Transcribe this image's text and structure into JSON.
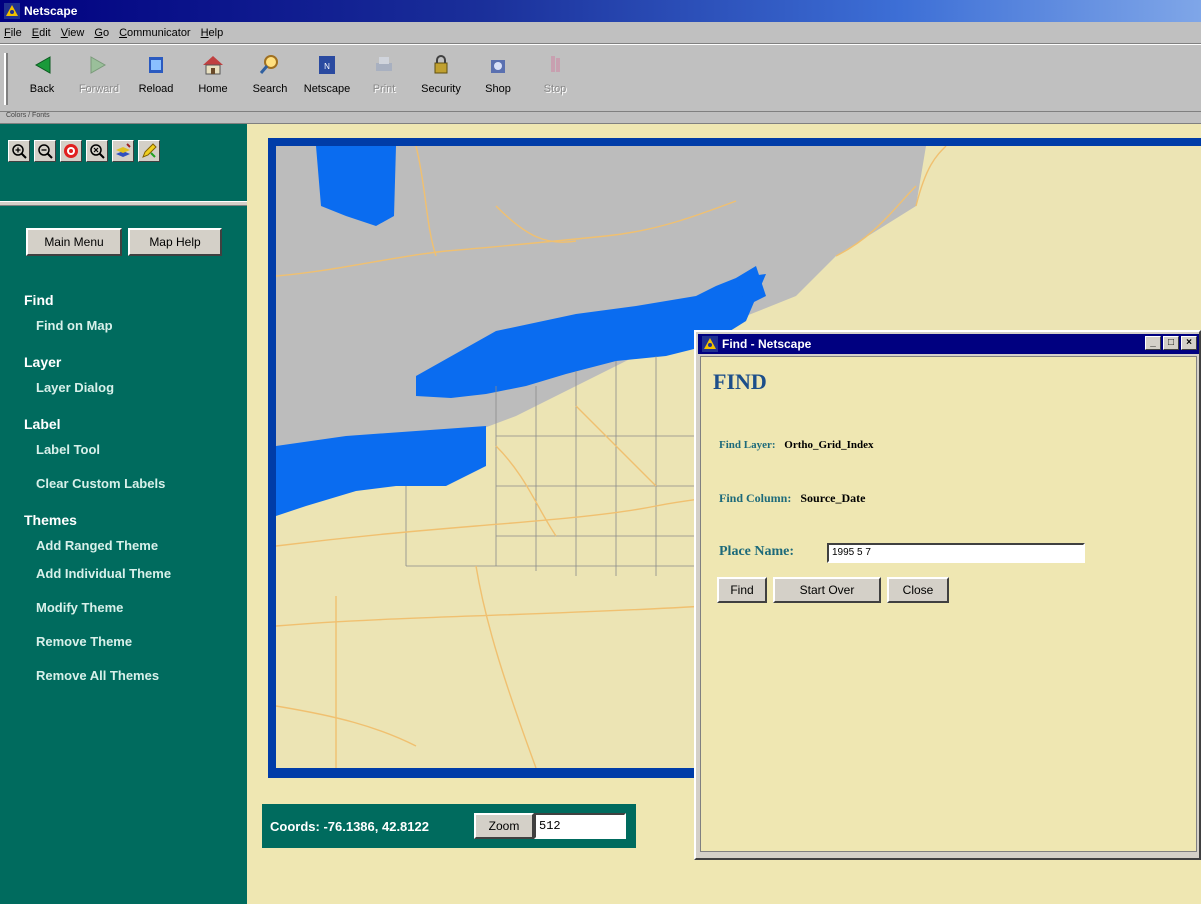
{
  "window": {
    "title": "Netscape"
  },
  "menu": [
    "File",
    "Edit",
    "View",
    "Go",
    "Communicator",
    "Help"
  ],
  "toolbar": [
    {
      "label": "Back",
      "icon": "back-icon",
      "enabled": true
    },
    {
      "label": "Forward",
      "icon": "forward-icon",
      "enabled": false
    },
    {
      "label": "Reload",
      "icon": "reload-icon",
      "enabled": true
    },
    {
      "label": "Home",
      "icon": "home-icon",
      "enabled": true
    },
    {
      "label": "Search",
      "icon": "search-icon",
      "enabled": true
    },
    {
      "label": "Netscape",
      "icon": "netscape-icon",
      "enabled": true
    },
    {
      "label": "Print",
      "icon": "print-icon",
      "enabled": false
    },
    {
      "label": "Security",
      "icon": "security-icon",
      "enabled": true
    },
    {
      "label": "Shop",
      "icon": "shop-icon",
      "enabled": true
    },
    {
      "label": "Stop",
      "icon": "stop-icon",
      "enabled": false
    }
  ],
  "tabstrip": {
    "label": "Colors / Fonts"
  },
  "sidebar": {
    "tools": [
      "zoom-in-icon",
      "zoom-out-icon",
      "center-icon",
      "zoom-box-icon",
      "layers-icon",
      "edit-icon"
    ],
    "main_menu": "Main Menu",
    "map_help": "Map Help",
    "sections": [
      {
        "heading": "Find",
        "items": [
          "Find on Map"
        ]
      },
      {
        "heading": "Layer",
        "items": [
          "Layer Dialog"
        ]
      },
      {
        "heading": "Label",
        "items": [
          "Label Tool",
          "Clear Custom Labels"
        ]
      },
      {
        "heading": "Themes",
        "items": [
          "Add Ranged Theme",
          "Add Individual Theme",
          "Modify Theme",
          "Remove Theme",
          "Remove All Themes"
        ]
      }
    ]
  },
  "coords": {
    "text": "Coords: -76.1386, 42.8122",
    "zoom_label": "Zoom",
    "zoom_value": "512"
  },
  "dialog": {
    "title": "Find - Netscape",
    "heading": "FIND",
    "find_layer_label": "Find Layer:",
    "find_layer_value": "Ortho_Grid_Index",
    "find_column_label": "Find Column:",
    "find_column_value": "Source_Date",
    "place_name_label": "Place Name:",
    "place_name_value": "1995 5 7",
    "buttons": {
      "find": "Find",
      "start_over": "Start Over",
      "close": "Close"
    }
  },
  "colors": {
    "sidebar": "#006b5e",
    "water": "#0a6cf0",
    "land": "#ece4b4",
    "gray_region": "#bcbcbc",
    "roads": "#f0c070"
  }
}
